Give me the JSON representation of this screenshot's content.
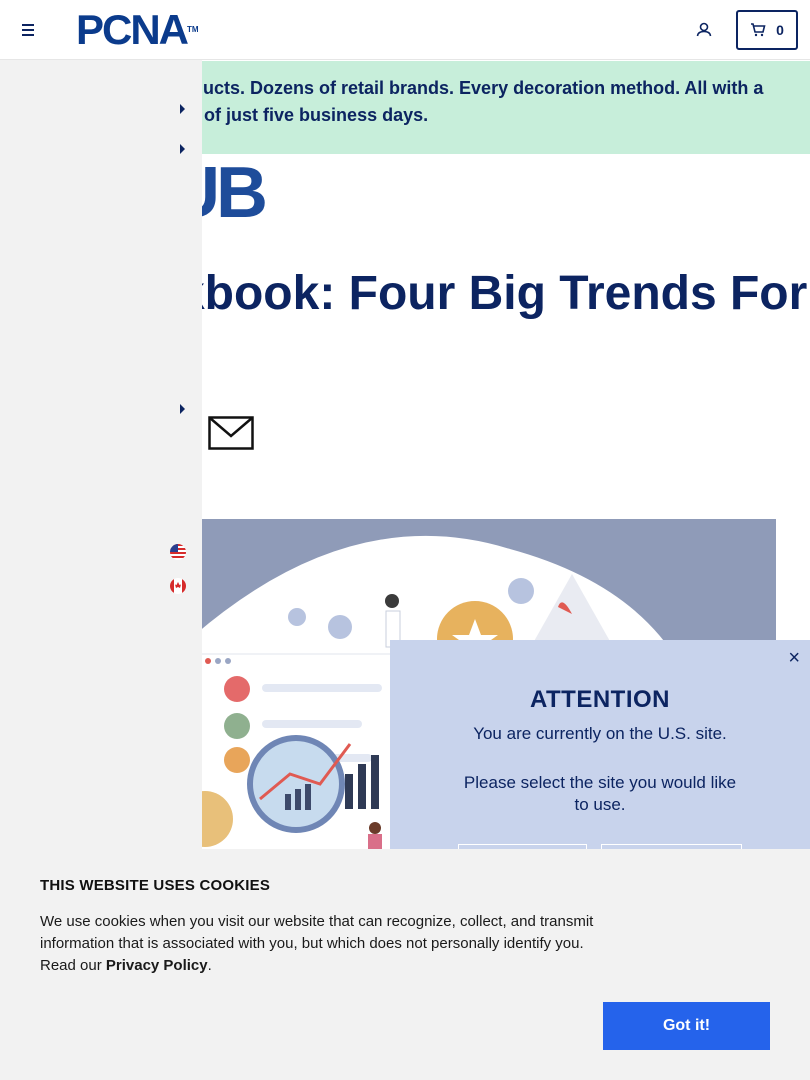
{
  "header": {
    "logo_text": "PCNA",
    "logo_tm": "TM",
    "cart_count": "0"
  },
  "banner": {
    "text": "Thousands of products. Dozens of retail brands. Every decoration method. All with a standard lead time of just five business days."
  },
  "content": {
    "hub_logo": "HUB",
    "article_title": "Lookbook: Four Big Trends For"
  },
  "modal": {
    "title": "ATTENTION",
    "line1": "You are currently on the U.S. site.",
    "line2": "Please select the site you would like to use.",
    "close_glyph": "×"
  },
  "cookie": {
    "title": "THIS WEBSITE USES COOKIES",
    "text_before_link": "We use cookies when you visit our website that can recognize, collect, and transmit information that is associated with you, but which does not personally identify you. Read our ",
    "link_text": "Privacy Policy",
    "text_after_link": ".",
    "button_label": "Got it!"
  },
  "colors": {
    "navy": "#0c2461",
    "banner_bg": "#c7eeda",
    "modal_bg": "#c8d3ec",
    "cookie_button": "#2563eb",
    "hero_bg": "#8f9bb8"
  },
  "icons": [
    "menu-icon",
    "account-icon",
    "cart-icon",
    "mail-icon",
    "caret-right-icon",
    "us-flag-icon",
    "canada-flag-icon",
    "close-icon"
  ]
}
